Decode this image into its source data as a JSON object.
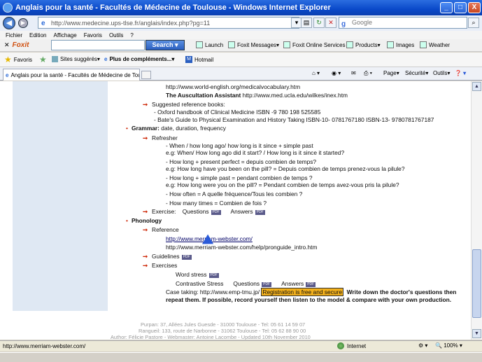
{
  "window": {
    "title": "Anglais pour la santé - Facultés de Médecine de Toulouse - Windows Internet Explorer",
    "minimize": "_",
    "maximize": "□",
    "close": "X"
  },
  "address": {
    "url": "http://www.medecine.ups-tlse.fr/anglais/index.php?pg=11",
    "search_placeholder": "Google"
  },
  "menu": [
    "Fichier",
    "Edition",
    "Affichage",
    "Favoris",
    "Outils",
    "?"
  ],
  "toolbar": {
    "brand": "Foxit",
    "search_label": "Search",
    "items": [
      "Launch",
      "Foxit Messages",
      "Foxit Online Services",
      "Products",
      "Images",
      "Weather"
    ]
  },
  "favorites": {
    "label": "Favoris",
    "items": [
      "Sites suggérés",
      "Plus de compléments...",
      "Hotmail"
    ]
  },
  "tabs": {
    "active_label": "Anglais pour la santé - Facultés de Médecine de Toulo...",
    "commands": [
      "Page",
      "Sécurité",
      "Outils"
    ]
  },
  "content": {
    "vocab_url": "http://www.world-english.org/medicalvocabulary.htm",
    "auscultation_title": "The Auscultation Assistant",
    "auscultation_url": "http://www.med.ucla.edu/wilkes/inex.htm",
    "suggested_books": "Suggested reference books:",
    "book_1": "- Oxford handbook of Clinical Medicine ISBN -9 780 198 525585",
    "book_2": "- Bate's Guide to Physical Examination and History Taking ISBN-10- 0781767180 ISBN-13- 9780781767187",
    "grammar_title": "Grammar:",
    "grammar_topics": "date, duration, frequency",
    "refresher": "Refresher",
    "r1a": "- When / how long ago/ how long is it since + simple past",
    "r1b": "e.g: When/ How long ago did it start? / How long is it since it started?",
    "r2a": "- How long + present perfect = depuis combien de temps?",
    "r2b": "e.g: How long have you been on the pill?   = Depuis combien de temps prenez-vous la pilule?",
    "r3a": "- How long + simple past = pendant combien de temps ?",
    "r3b": "e.g: How long were you on the pill?    = Pendant combien de temps avez-vous pris la pilule?",
    "r4": "- How often = A quelle fréquence/Tous les combien ?",
    "r5": "- How many times = Combien de fois ?",
    "exercise_label": "Exercise:",
    "questions": "Questions",
    "answers": "Answers",
    "pdf": "PDF",
    "phonology_title": "Phonology",
    "reference": "Reference",
    "mw_url": "http://www.merriam-webster.com/",
    "mw_help_url": "http://www.merriam-webster.com/help/pronguide_intro.htm",
    "guidelines": "Guidelines",
    "exercises": "Exercises",
    "word_stress": "Word stress",
    "contrastive_stress": "Contrastive Stress",
    "case_taking": "Case taking: http://www.emp-tmu.jp/",
    "registration": "Registration is free and secure",
    "case_instr_1": "Write down the doctor's questions then",
    "case_instr_2": "repeat them. If possible, record yourself then listen to the model & compare with your own production."
  },
  "footer": {
    "line1": "Purpan: 37, Allées Jules Guesde - 31000 Toulouse - Tel: 05 61 14 59 07",
    "line2": "Rangueil: 133, route de Narbonne - 31062 Toulouse - Tel: 05 62 88 90 00",
    "line3": "Author: Félicie Pastore    -    Webmaster: Antoine Lacombe    -    Updated 10th November 2010"
  },
  "status": {
    "url": "http://www.merriam-webster.com/",
    "zone": "Internet",
    "zoom": "100%"
  }
}
